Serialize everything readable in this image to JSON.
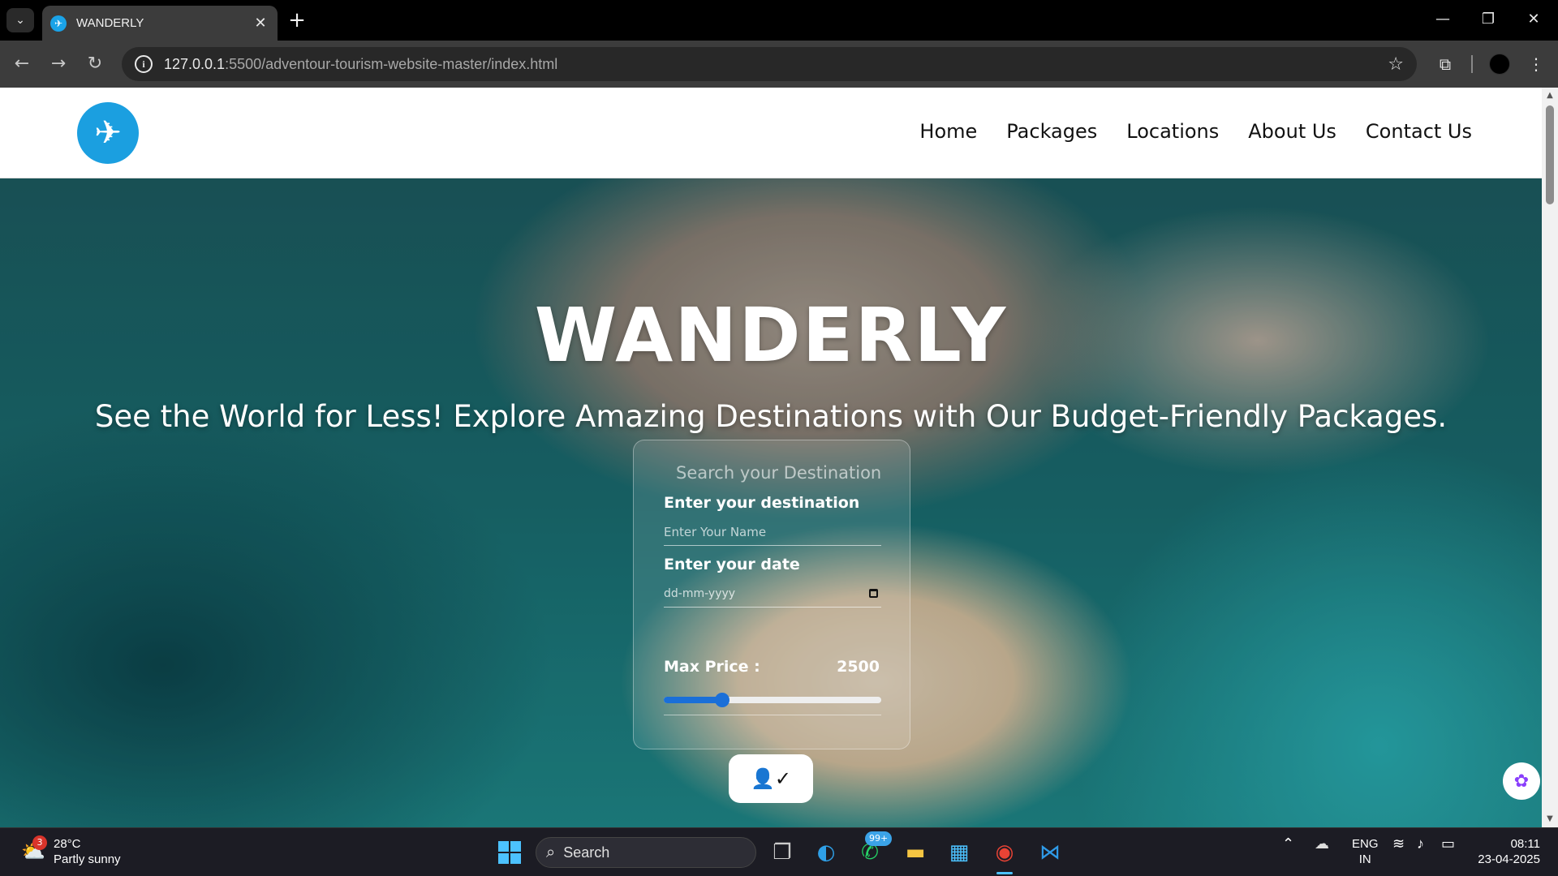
{
  "browser": {
    "tab_title": "WANDERLY",
    "url_host": "127.0.0.1",
    "url_path": ":5500/adventour-tourism-website-master/index.html"
  },
  "site": {
    "nav": [
      "Home",
      "Packages",
      "Locations",
      "About Us",
      "Contact Us"
    ],
    "hero_title": "WANDERLY",
    "hero_subtitle": "See the World for Less! Explore Amazing Destinations with Our Budget-Friendly Packages.",
    "search": {
      "card_title": "Search your Destination",
      "destination_label": "Enter your destination",
      "destination_placeholder": "Enter Your Name",
      "date_label": "Enter your date",
      "date_placeholder": "dd-mm-yyyy",
      "price_label": "Max Price :",
      "price_value": "2500",
      "price_fraction": 0.27
    }
  },
  "taskbar": {
    "weather_temp": "28°C",
    "weather_desc": "Partly sunny",
    "weather_badge": "3",
    "search_label": "Search",
    "whatsapp_badge": "99+",
    "lang_top": "ENG",
    "lang_bottom": "IN",
    "time": "08:11",
    "date": "23-04-2025"
  },
  "colors": {
    "accent": "#1a6fd8",
    "logo": "#1b9fe0"
  }
}
